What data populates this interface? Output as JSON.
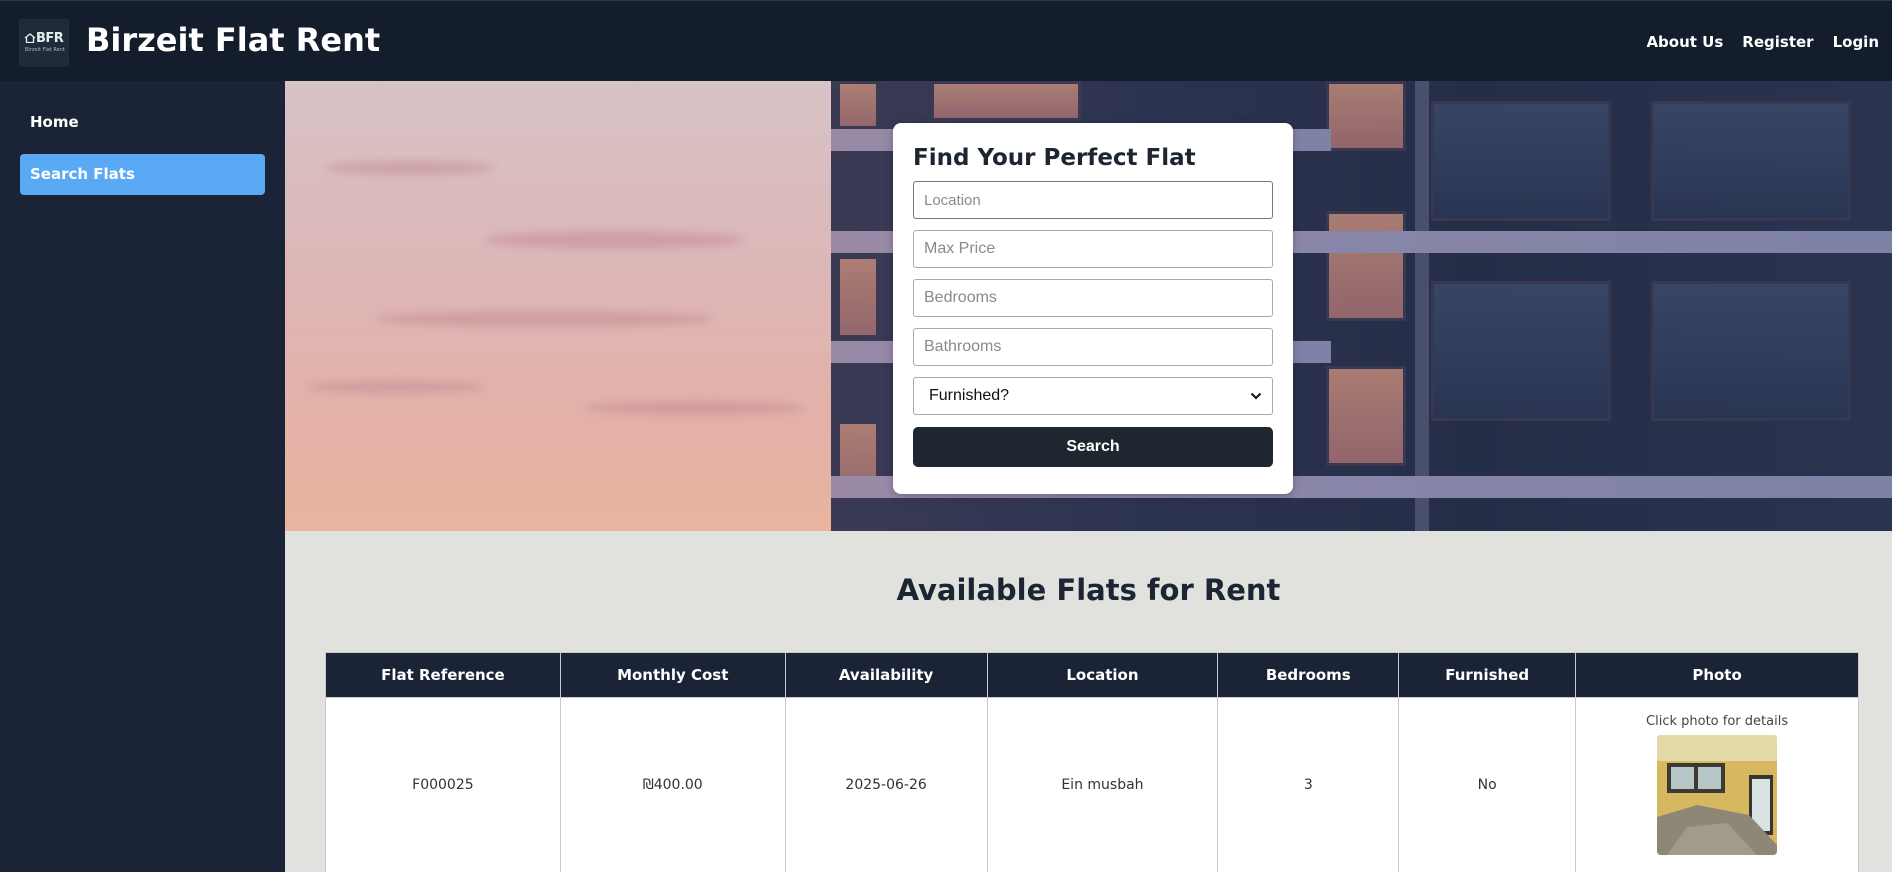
{
  "header": {
    "logo_text": "BFR",
    "logo_subtext": "Birzeit Flat Rent",
    "title": "Birzeit Flat Rent",
    "nav": [
      "About Us",
      "Register",
      "Login"
    ]
  },
  "sidebar": {
    "items": [
      {
        "label": "Home",
        "active": false
      },
      {
        "label": "Search Flats",
        "active": true
      }
    ]
  },
  "search": {
    "title": "Find Your Perfect Flat",
    "location_placeholder": "Location",
    "max_price_placeholder": "Max Price",
    "bedrooms_placeholder": "Bedrooms",
    "bathrooms_placeholder": "Bathrooms",
    "furnished_selected": "Furnished?",
    "button_label": "Search"
  },
  "listing": {
    "title": "Available Flats for Rent",
    "columns": [
      "Flat Reference",
      "Monthly Cost",
      "Availability",
      "Location",
      "Bedrooms",
      "Furnished",
      "Photo"
    ],
    "rows": [
      {
        "reference": "F000025",
        "cost": "₪400.00",
        "availability": "2025-06-26",
        "location": "Ein musbah",
        "bedrooms": "3",
        "furnished": "No",
        "photo_hint": "Click photo for details"
      }
    ]
  },
  "colors": {
    "header_bg": "#131d2b",
    "sidebar_bg": "#1a2436",
    "active_item": "#5aa9f5",
    "button_bg": "#1e2730",
    "listing_bg": "#e1e1dd"
  }
}
